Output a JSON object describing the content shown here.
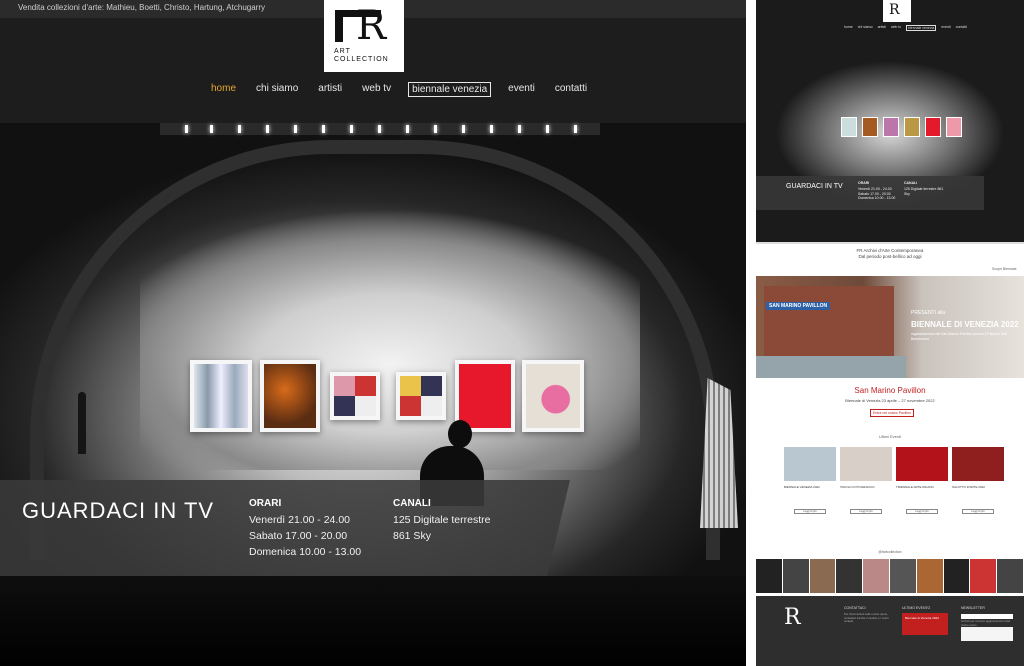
{
  "hero": {
    "tagline": "Vendita collezioni d'arte: Mathieu, Boetti, Christo, Hartung, Atchugarry",
    "logo_text": "ART COLLECTION",
    "logo_letter": "R",
    "nav": [
      {
        "label": "home",
        "state": "active"
      },
      {
        "label": "chi siamo",
        "state": ""
      },
      {
        "label": "artisti",
        "state": ""
      },
      {
        "label": "web tv",
        "state": ""
      },
      {
        "label": "biennale venezia",
        "state": "boxed"
      },
      {
        "label": "eventi",
        "state": ""
      },
      {
        "label": "contatti",
        "state": ""
      }
    ],
    "tv_title": "GUARDACI IN TV",
    "orari_title": "ORARI",
    "orari": [
      "Venerdì 21.00 - 24.00",
      "Sabato 17.00 - 20.00",
      "Domenica 10.00 - 13.00"
    ],
    "canali_title": "CANALI",
    "canali": [
      "125 Digitale terrestre",
      "861 Sky"
    ],
    "colors": {
      "active": "#e3a72f",
      "panel": "#3a3a3a"
    }
  },
  "preview": {
    "logo_letter": "R",
    "nav": [
      {
        "label": "home",
        "state": ""
      },
      {
        "label": "chi siamo",
        "state": ""
      },
      {
        "label": "artisti",
        "state": ""
      },
      {
        "label": "web tv",
        "state": ""
      },
      {
        "label": "biennale venezia",
        "state": "boxed"
      },
      {
        "label": "eventi",
        "state": ""
      },
      {
        "label": "contatti",
        "state": ""
      }
    ],
    "tv_title": "GUARDACI IN TV",
    "orari_title": "ORARI",
    "orari_text": "Venerdì 21.00 - 24.00 Sabato 17.00 - 20.00 Domenica 10.00 - 13.00",
    "canali_title": "CANALI",
    "canali_text": "125 Digitale terrestre 861 Sky",
    "intro_title": "FR Archivi d'Arte Contemporanea",
    "intro_sub": "Dal periodo post-bellico ad oggi",
    "side_label": "Scopri Biennale",
    "banner_label": "SAN MARINO PAVILLON",
    "presenti": "PRESENTI alla",
    "biennale": "BIENNALE DI VENEZIA 2022",
    "organizzazione": "organizzazione del San Marino Pavillon presso il Palazzo San Bartolomeo",
    "pavillon_title": "San Marino Pavillon",
    "pavillon_dates": "Biennale di Venezia 23 aprile – 27 novembre 2022",
    "pavillon_btn": "Entra nel nostro Pavillon",
    "eventi_title": "Ultimi Eventi",
    "cards": [
      {
        "title": "BIENNALE VENEZIA 2022",
        "btn": "Leggi di più",
        "color": "#b9c7d0"
      },
      {
        "title": "TAVOLO FOTOGRAFICO",
        "btn": "Leggi di più",
        "color": "#d8d0c8"
      },
      {
        "title": "TRIENNALE ARTE MILANO",
        "btn": "Leggi di più",
        "color": "#b4121a"
      },
      {
        "title": "SALOTTO D'ARTE 2022",
        "btn": "Leggi di più",
        "color": "#8f1f1f"
      }
    ],
    "follow": "@fartcollection",
    "strip_colors": [
      "#222",
      "#444",
      "#8a6a50",
      "#333",
      "#b88",
      "#555",
      "#a63",
      "#222",
      "#c33",
      "#444"
    ],
    "footer": {
      "col1_head": "CONTATTACI",
      "col1_text": "Per informazioni sulle nostre opere, contattaci tramite il modulo o i nostri recapiti.",
      "col2_head": "ULTIMO EVENTO",
      "promo_text": "Biennale di Venezia 2022",
      "col3_head": "NEWSLETTER",
      "col3_text": "Iscriviti per ricevere aggiornamenti sulle nostre opere."
    }
  }
}
